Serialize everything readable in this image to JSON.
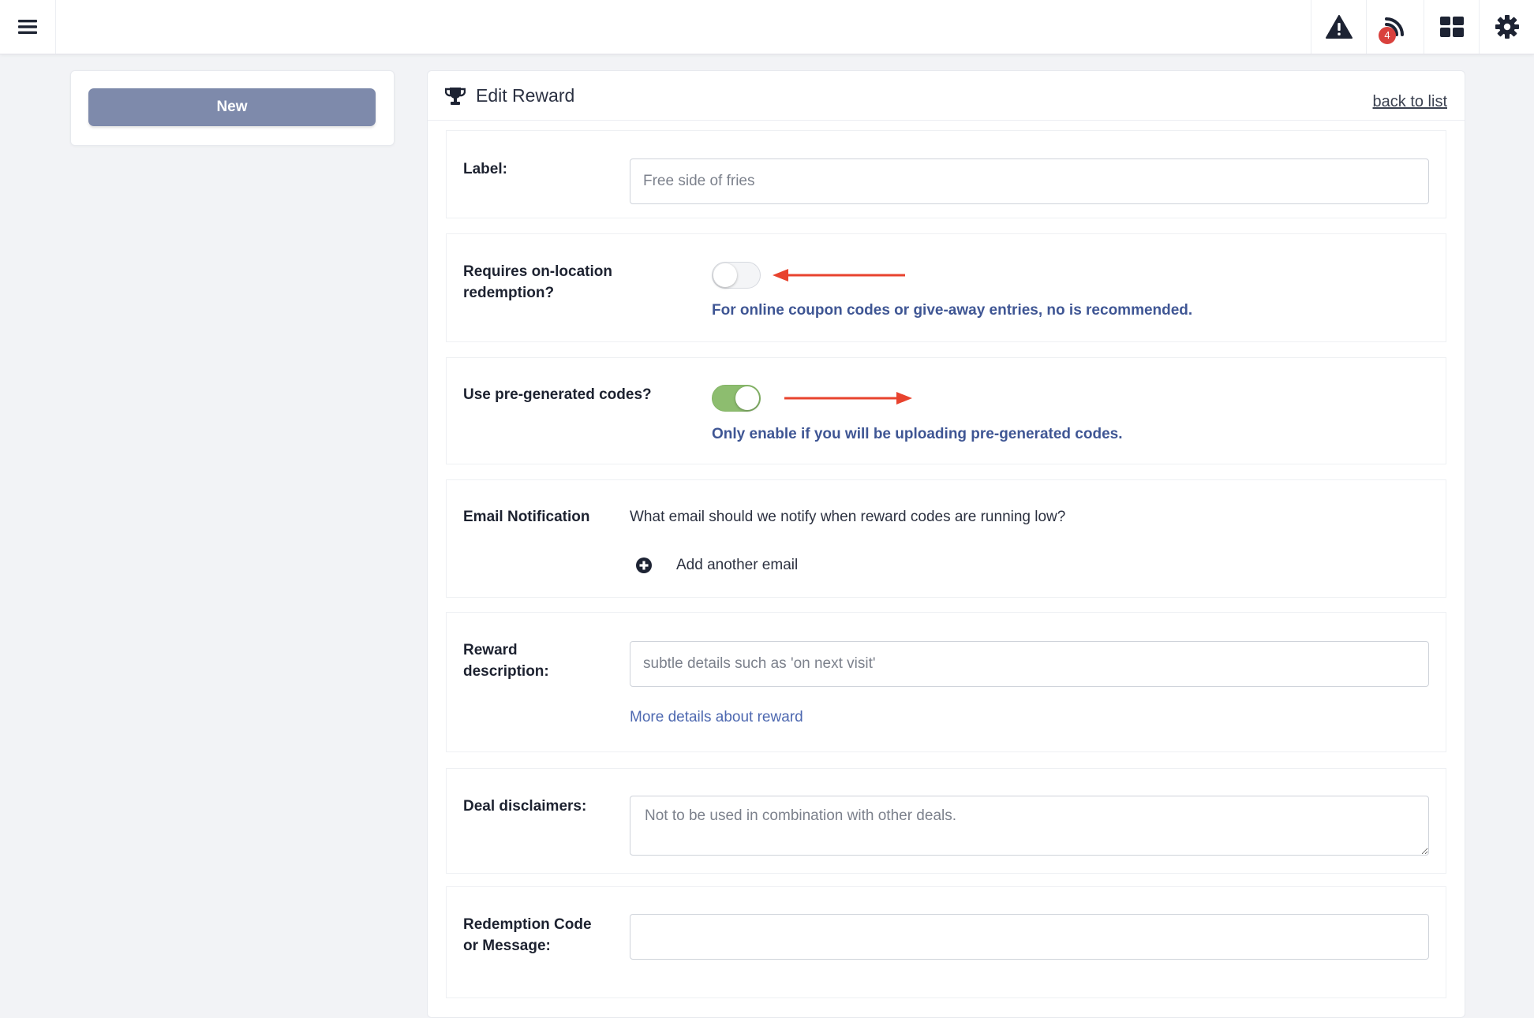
{
  "topbar": {
    "menu_icon": "hamburger-icon",
    "icons": [
      "warning-icon",
      "feed-icon",
      "grid-icon",
      "gear-icon"
    ],
    "feed_badge": "4"
  },
  "sidebar": {
    "new_button": "New"
  },
  "card": {
    "title": "Edit Reward",
    "back_link": "back to list"
  },
  "form": {
    "label": {
      "label": "Label:",
      "placeholder": "Free side of fries"
    },
    "on_location": {
      "label_line1": "Requires on-location",
      "label_line2": "redemption?",
      "enabled": false,
      "hint": "For online coupon codes or give-away entries, no is recommended."
    },
    "pregenerated": {
      "label": "Use pre-generated codes?",
      "enabled": true,
      "hint": "Only enable if you will be uploading pre-generated codes."
    },
    "email": {
      "label": "Email Notification",
      "question": "What email should we notify when reward codes are running low?",
      "add_label": "Add another email"
    },
    "description": {
      "label_line1": "Reward",
      "label_line2": "description:",
      "placeholder": "subtle details such as 'on next visit'",
      "more_link": "More details about reward"
    },
    "disclaimers": {
      "label": "Deal disclaimers:",
      "placeholder": "Not to be used in combination with other deals."
    },
    "redemption": {
      "label_line1": "Redemption Code",
      "label_line2": "or Message:",
      "value": ""
    }
  },
  "colors": {
    "accent_blue": "#3f5694",
    "toggle_on": "#8dbd6f",
    "arrow_red": "#e8432e",
    "new_button": "#7e8aab"
  }
}
